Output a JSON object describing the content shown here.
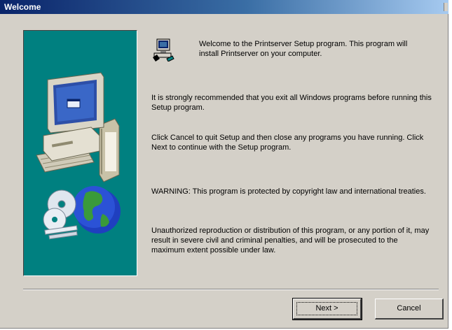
{
  "window": {
    "title": "Welcome"
  },
  "welcome": {
    "text": "Welcome to the Printserver Setup program. This program will install Printserver on your computer."
  },
  "paragraphs": {
    "recommend": "It is strongly recommended that you exit all Windows programs before running this Setup program.",
    "cancel": "Click Cancel to quit Setup and then close any programs you have running. Click Next to continue with the Setup program.",
    "warning": "WARNING: This program is protected by copyright law and international treaties.",
    "unauthorized": "Unauthorized reproduction or distribution of this program, or any portion of it, may result in severe civil and criminal penalties, and will be prosecuted to the maximum extent possible under law."
  },
  "buttons": {
    "next": "Next >",
    "cancel": "Cancel"
  },
  "icons": {
    "panel_computer": "computer-icon",
    "panel_globe": "globe-cd-icon",
    "setup": "setup-computer-icon"
  },
  "colors": {
    "panel": "#008080",
    "title_gradient_start": "#0a246a",
    "title_gradient_end": "#a6caf0",
    "face": "#d4d0c8"
  }
}
